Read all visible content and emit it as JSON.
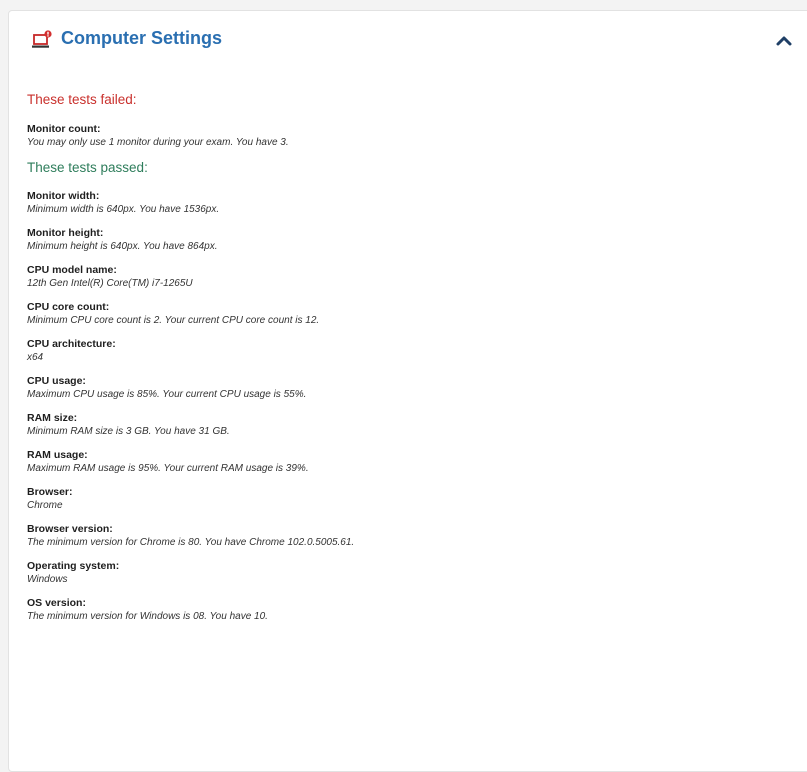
{
  "panel": {
    "title": "Computer Settings",
    "title_icon": "computer-warning-icon",
    "collapse_icon": "chevron-up-icon",
    "accent_color": "#2a6fb1"
  },
  "failed": {
    "heading": "These tests failed:",
    "color": "#c9302c",
    "checks": [
      {
        "name": "Monitor count:",
        "desc": "You may only use 1 monitor during your exam. You have 3."
      }
    ]
  },
  "passed": {
    "heading": "These tests passed:",
    "color": "#2e7d5b",
    "checks": [
      {
        "name": "Monitor width:",
        "desc": "Minimum width is 640px. You have 1536px."
      },
      {
        "name": "Monitor height:",
        "desc": "Minimum height is 640px. You have 864px."
      },
      {
        "name": "CPU model name:",
        "desc": "12th Gen Intel(R) Core(TM) i7-1265U"
      },
      {
        "name": "CPU core count:",
        "desc": "Minimum CPU core count is 2. Your current CPU core count is 12."
      },
      {
        "name": "CPU architecture:",
        "desc": "x64"
      },
      {
        "name": "CPU usage:",
        "desc": "Maximum CPU usage is 85%. Your current CPU usage is 55%."
      },
      {
        "name": "RAM size:",
        "desc": "Minimum RAM size is 3 GB. You have 31 GB."
      },
      {
        "name": "RAM usage:",
        "desc": "Maximum RAM usage is 95%. Your current RAM usage is 39%."
      },
      {
        "name": "Browser:",
        "desc": "Chrome"
      },
      {
        "name": "Browser version:",
        "desc": "The minimum version for Chrome is 80. You have Chrome 102.0.5005.61."
      },
      {
        "name": "Operating system:",
        "desc": "Windows"
      },
      {
        "name": "OS version:",
        "desc": "The minimum version for Windows is 08. You have 10."
      }
    ]
  }
}
